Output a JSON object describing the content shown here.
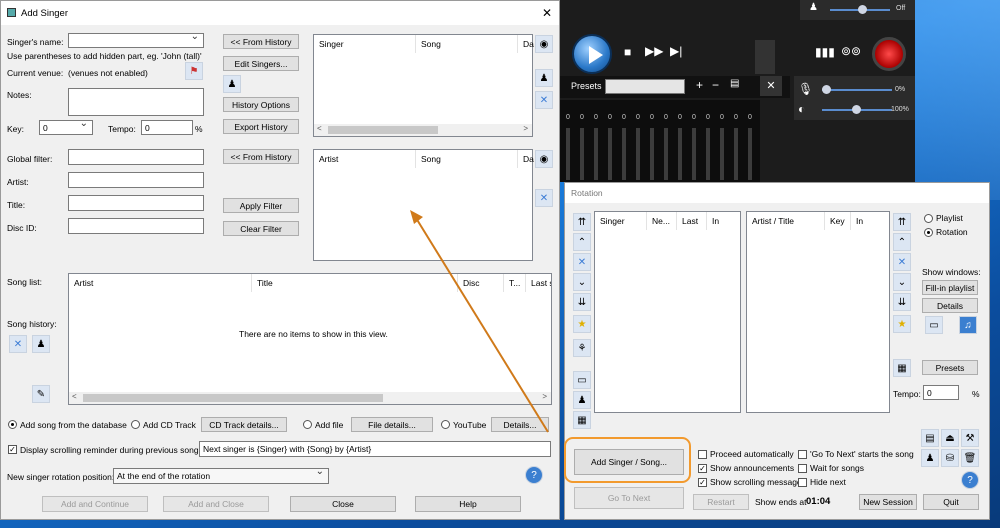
{
  "player": {
    "off_label": "Off",
    "presets_label": "Presets",
    "vol1": "0%",
    "vol2": "100%",
    "close_glyph": "✕"
  },
  "add_singer": {
    "title": "Add Singer",
    "singer_name_label": "Singer's name:",
    "hint": "Use parentheses to add hidden part, eg. 'John (tall)'",
    "current_venue_label": "Current venue:",
    "current_venue_value": "(venues not enabled)",
    "notes_label": "Notes:",
    "key_label": "Key:",
    "key_value": "0",
    "tempo_label": "Tempo:",
    "tempo_value": "0",
    "tempo_unit": "%",
    "from_history_1": "<< From History",
    "edit_singers": "Edit Singers...",
    "history_options": "History Options",
    "export_history": "Export History",
    "history_list_columns": [
      "Singer",
      "Song",
      "Dat"
    ],
    "global_filter_label": "Global filter:",
    "artist_label": "Artist:",
    "title_label": "Title:",
    "disc_id_label": "Disc ID:",
    "from_history_2": "<< From History",
    "apply_filter": "Apply Filter",
    "clear_filter": "Clear Filter",
    "filter_list_columns": [
      "Artist",
      "Song",
      "Dat"
    ],
    "song_list_label": "Song list:",
    "song_history_label": "Song history:",
    "song_list_columns": [
      "Artist",
      "Title",
      "Disc",
      "T...",
      "Last s"
    ],
    "empty_text": "There are no items to show in this view.",
    "source_db": "Add song from the database",
    "source_cd": "Add CD Track",
    "cd_details": "CD Track details...",
    "source_file": "Add file",
    "file_details": "File details...",
    "source_youtube": "YouTube",
    "details": "Details...",
    "reminder_label": "Display scrolling reminder during previous song:",
    "reminder_value": "Next singer is {Singer} with {Song} by {Artist}",
    "rotation_position_label": "New singer rotation position:",
    "rotation_position_value": "At the end of the rotation",
    "add_continue": "Add and Continue",
    "add_close": "Add and Close",
    "close": "Close",
    "help": "Help",
    "close_glyph": "✕"
  },
  "rotation": {
    "title": "Rotation",
    "singer_columns": [
      "Singer",
      "Ne...",
      "Last",
      "In"
    ],
    "song_columns": [
      "Artist / Title",
      "Key",
      "In"
    ],
    "playlist": "Playlist",
    "rotation": "Rotation",
    "show_windows_label": "Show windows:",
    "fill_in_playlist": "Fill-in playlist",
    "details": "Details",
    "presets": "Presets",
    "tempo_label": "Tempo:",
    "tempo_value": "0",
    "tempo_unit": "%",
    "add_singer_song": "Add Singer / Song...",
    "go_to_next": "Go To Next",
    "restart": "Restart",
    "proceed_auto": "Proceed automatically",
    "show_announcements": "Show announcements",
    "show_scrolling": "Show scrolling message",
    "go_to_next_starts": "'Go To Next' starts the song",
    "wait_for_songs": "Wait for songs",
    "hide_next": "Hide next",
    "show_ends_label": "Show ends at",
    "show_ends_value": "01:04",
    "new_session": "New Session",
    "quit": "Quit"
  },
  "colors": {
    "highlight": "#f29a2e",
    "window_bg": "#f0f0f0",
    "desktop": "#1a7fe0"
  }
}
